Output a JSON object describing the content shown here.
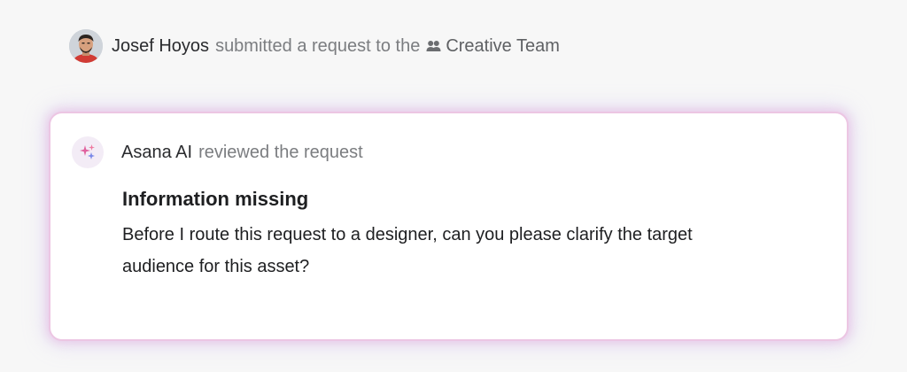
{
  "activity": {
    "user_name": "Josef Hoyos",
    "action_text": "submitted a request to the",
    "team_icon": "team-icon",
    "team_name": "Creative Team"
  },
  "ai_review": {
    "icon": "sparkle-icon",
    "author": "Asana AI",
    "action_text": "reviewed the request",
    "title": "Information missing",
    "message": "Before I route this request to a designer, can you please clarify the target audience for this asset?"
  },
  "colors": {
    "background": "#f7f7f7",
    "card_border": "#ecc6e3",
    "sparkle_pink": "#e0629e",
    "sparkle_blue": "#7a88e8"
  }
}
